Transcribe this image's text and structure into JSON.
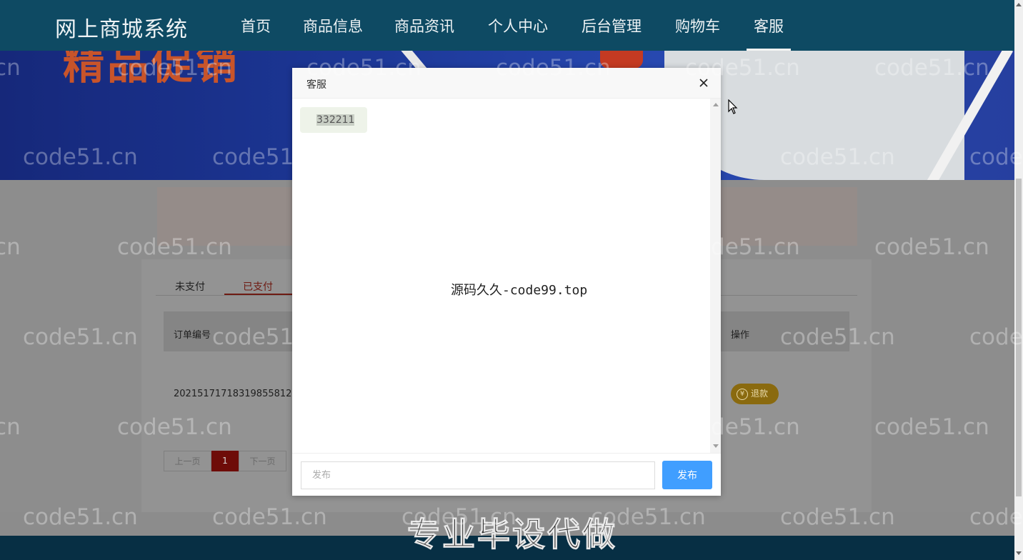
{
  "header": {
    "brand": "网上商城系统",
    "nav": [
      "首页",
      "商品信息",
      "商品资讯",
      "个人中心",
      "后台管理",
      "购物车",
      "客服"
    ],
    "active_nav": "客服"
  },
  "banner": {
    "partial_text": "精品促销"
  },
  "orders": {
    "tabs": [
      "未支付",
      "已支付"
    ],
    "active_tab": "已支付",
    "columns": {
      "order_no": "订单编号",
      "actions": "操作"
    },
    "rows": [
      {
        "order_no": "20215171718319855812",
        "action": "退款"
      }
    ],
    "pagination": {
      "prev": "上一页",
      "current": "1",
      "next": "下一页"
    }
  },
  "dialog": {
    "title": "客服",
    "message": "332211",
    "center_text": "源码久久-code99.top",
    "input_placeholder": "发布",
    "send_label": "发布"
  },
  "watermark": "code51.cn",
  "footer_promo": "专业毕设代做",
  "colors": {
    "nav_bg": "#0e4a63",
    "send_button": "#409eff",
    "active_page": "#6e0c08",
    "refund_button": "#8a6a0f"
  },
  "icons": {
    "close": "close-icon",
    "yen": "yen-icon",
    "cursor": "mouse-cursor-icon"
  }
}
